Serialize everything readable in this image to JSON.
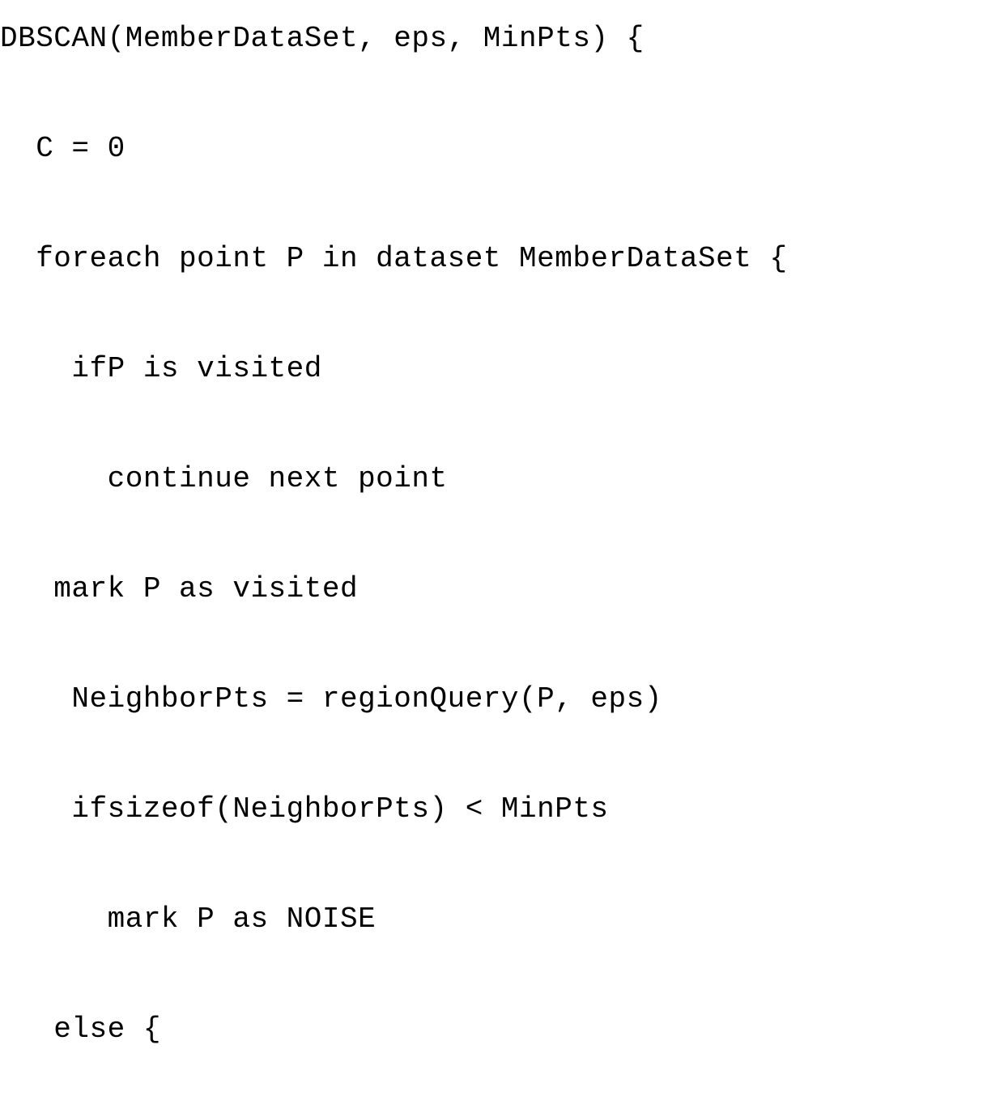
{
  "code": {
    "lines": [
      "DBSCAN(MemberDataSet, eps, MinPts) {",
      "  C = 0",
      "  foreach point P in dataset MemberDataSet {",
      "    ifP is visited",
      "      continue next point",
      "   mark P as visited",
      "    NeighborPts = regionQuery(P, eps)",
      "    ifsizeof(NeighborPts) < MinPts",
      "      mark P as NOISE",
      "   else {"
    ]
  }
}
